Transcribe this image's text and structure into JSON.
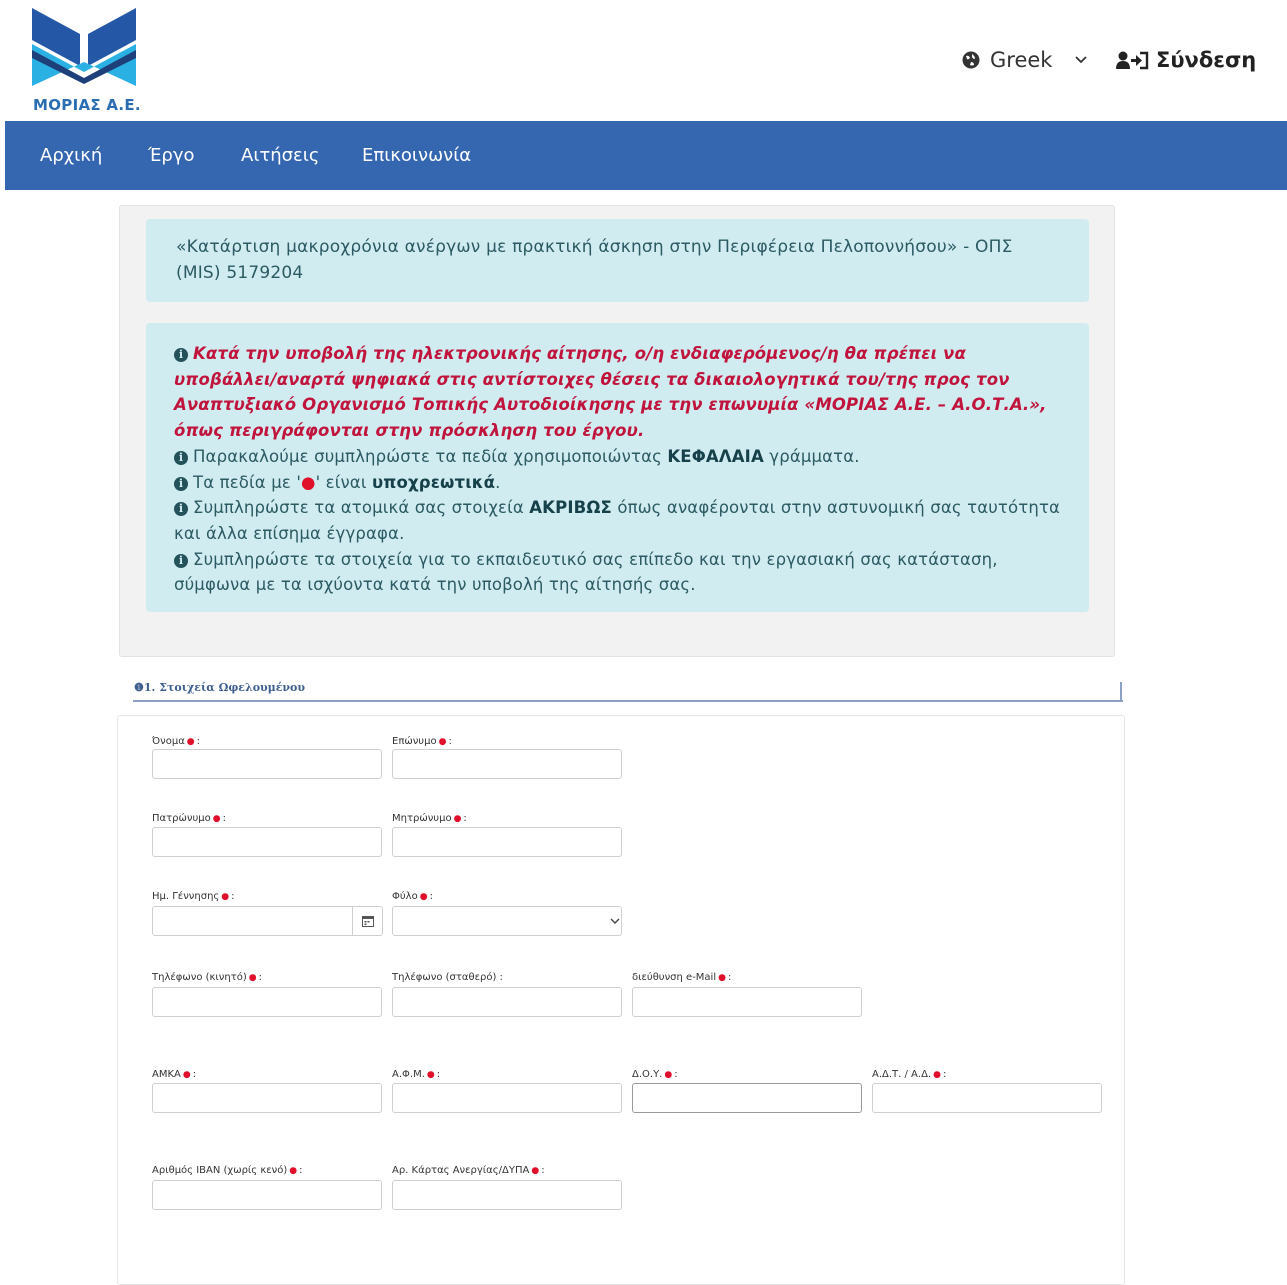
{
  "brand": {
    "name": "ΜΟΡΙΑΣ Α.Ε.",
    "logo_icon": "moria-logo-icon"
  },
  "header": {
    "language": "Greek",
    "login_label": "Σύνδεση"
  },
  "nav": {
    "items": [
      "Αρχική",
      "Έργο",
      "Αιτήσεις",
      "Επικοινωνία"
    ]
  },
  "project_title": "«Κατάρτιση μακροχρόνια ανέργων με πρακτική άσκηση στην Περιφέρεια Πελοποννήσου» - ΟΠΣ (MIS) 5179204",
  "notice": {
    "warning_lines": [
      "Κατά την υποβολή της ηλεκτρονικής αίτησης, ο/η ενδιαφερόμενος/η θα πρέπει να",
      "υποβάλλει/αναρτά ψηφιακά στις αντίστοιχες θέσεις τα δικαιολογητικά του/της προς τον",
      "Αναπτυξιακό Οργανισμό Τοπικής Αυτοδιοίκησης με την επωνυμία «ΜΟΡΙΑΣ Α.Ε. – Α.Ο.Τ.Α.»,",
      "όπως περιγράφονται στην πρόσκληση του έργου."
    ],
    "caps_pre": "Παρακαλούμε συμπληρώστε τα πεδία χρησιμοποιώντας",
    "caps_bold": "ΚΕΦΑΛΑΙΑ",
    "caps_post": "γράμματα.",
    "req_pre": "Τα πεδία με '",
    "req_post": "' είναι",
    "req_bold": "υποχρεωτικά",
    "req_end": ".",
    "exact_pre": "Συμπληρώστε τα ατομικά σας στοιχεία",
    "exact_bold": "ΑΚΡΙΒΩΣ",
    "exact_post": "όπως αναφέρονται στην αστυνομική σας ταυτότητα",
    "exact_cont": "και άλλα επίσημα έγγραφα.",
    "edu_line1": "Συμπληρώστε τα στοιχεία για το εκπαιδευτικό σας επίπεδο και την εργασιακή σας κατάσταση,",
    "edu_line2": "σύμφωνα με τα ισχύοντα κατά την υποβολή της αίτησής σας."
  },
  "form": {
    "section_title": "1. Στοιχεία Ωφελουμένου",
    "fields": {
      "first_name": "Όνομα",
      "last_name": "Επώνυμο",
      "father_name": "Πατρώνυμο",
      "mother_name": "Μητρώνυμο",
      "birth_date": "Ημ. Γέννησης",
      "gender": "Φύλο",
      "mobile": "Τηλέφωνο (κινητό)",
      "landline": "Τηλέφωνο (σταθερό)",
      "email": "διεύθυνση e-Mail",
      "amka": "ΑΜΚΑ",
      "afm": "Α.Φ.Μ.",
      "doy": "Δ.Ο.Υ.",
      "adt": "Α.Δ.Τ. / Α.Δ.",
      "iban": "Αριθμός ΙΒΑΝ (χωρίς κενό)",
      "unemployment_card": "Αρ. Κάρτας Ανεργίας/ΔΥΠΑ"
    }
  },
  "colors": {
    "nav": "#3567b0",
    "alert_bg": "#d1ecf1",
    "warning": "#c0143c",
    "required": "#e0102a"
  }
}
